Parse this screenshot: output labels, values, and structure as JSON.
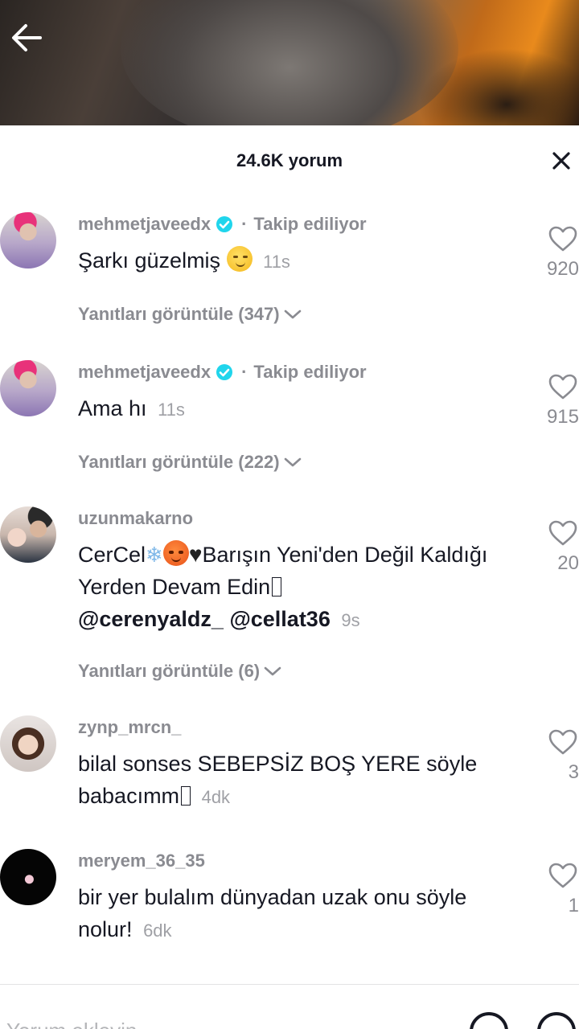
{
  "header": {
    "comment_count": "24.6K yorum"
  },
  "icons": {
    "back": "arrow-left-icon",
    "close": "close-icon",
    "like": "heart-outline-icon",
    "verified": "verified-badge-icon",
    "chevron": "chevron-down-icon",
    "mention": "at-icon",
    "emoji": "emoji-icon"
  },
  "colors": {
    "verified": "#20d5ec",
    "text_primary": "#161823",
    "text_secondary": "#8a8b91"
  },
  "comments": [
    {
      "username": "mehmetjaveedx",
      "verified": true,
      "separator": "·",
      "following": "Takip ediliyor",
      "text": "Şarkı güzelmiş",
      "time": "11s",
      "likes": "920",
      "replies": "Yanıtları görüntüle (347)"
    },
    {
      "username": "mehmetjaveedx",
      "verified": true,
      "separator": "·",
      "following": "Takip ediliyor",
      "text": "Ama hı",
      "time": "11s",
      "likes": "915",
      "replies": "Yanıtları görüntüle (222)"
    },
    {
      "username": "uzunmakarno",
      "text_part1": "CerCel",
      "text_part2": "Barışın Yeni'den Değil Kaldığı Yerden Devam Edin",
      "mention1": "@cerenyaldz_",
      "mention2": "@cellat36",
      "time": "9s",
      "likes": "20",
      "replies": "Yanıtları görüntüle (6)"
    },
    {
      "username": "zynp_mrcn_",
      "text": "bilal sonses SEBEPSİZ BOŞ YERE söyle babacımm",
      "time": "4dk",
      "likes": "3"
    },
    {
      "username": "meryem_36_35",
      "text": "bir yer bulalım dünyadan uzak onu söyle nolur!",
      "time": "6dk",
      "likes": "1"
    }
  ],
  "input": {
    "placeholder": "Yorum ekleyin..."
  }
}
